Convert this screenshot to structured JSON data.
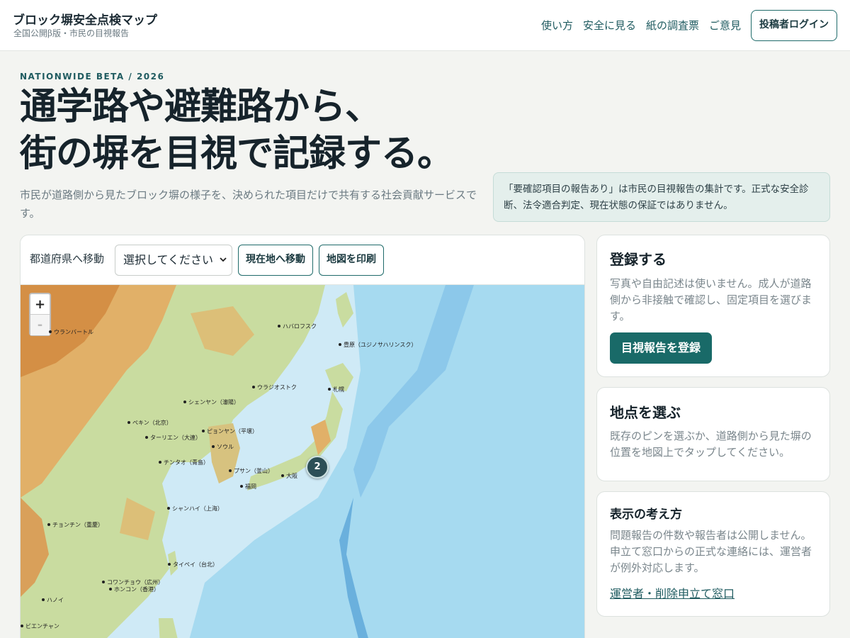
{
  "header": {
    "title": "ブロック塀安全点検マップ",
    "subtitle": "全国公開β版・市民の目視報告",
    "nav": [
      "使い方",
      "安全に見る",
      "紙の調査票",
      "ご意見"
    ],
    "login_label": "投稿者ログイン"
  },
  "hero": {
    "eyebrow": "NATIONWIDE BETA / 2026",
    "headline_line1": "通学路や避難路から、",
    "headline_line2": "街の塀を目視で記録する。",
    "lede": "市民が道路側から見たブロック塀の様子を、決められた項目だけで共有する社会貢献サービスです。",
    "notice": "「要確認項目の報告あり」は市民の目視報告の集計です。正式な安全診断、法令適合判定、現在状態の保証ではありません。"
  },
  "map": {
    "pref_label": "都道府県へ移動",
    "pref_select_value": "選択してください",
    "locate_label": "現在地へ移動",
    "print_label": "地図を印刷",
    "zoom_in": "+",
    "zoom_out": "-",
    "cluster_count": "2",
    "cities": [
      "ウランバートル",
      "ハバロフスク",
      "豊原（ユジノサハリンスク）",
      "札幌",
      "ウラジオストク",
      "シェンヤン（瀋陽）",
      "ペキン（北京）",
      "ピョンヤン（平壌）",
      "ターリエン（大連）",
      "ソウル",
      "チンタオ（青島）",
      "プサン（釜山）",
      "大阪",
      "福岡",
      "シャンハイ（上海）",
      "チョンチン（重慶）",
      "タイペイ（台北）",
      "コワンチョウ（広州）",
      "ホンコン（香港）",
      "ハノイ",
      "ビエンチャン"
    ]
  },
  "cards": {
    "register": {
      "title": "登録する",
      "body": "写真や自由記述は使いません。成人が道路側から非接触で確認し、固定項目を選びます。",
      "button": "目視報告を登録"
    },
    "select": {
      "title": "地点を選ぶ",
      "body": "既存のピンを選ぶか、道路側から見た塀の位置を地図上でタップしてください。"
    },
    "policy": {
      "title": "表示の考え方",
      "body": "問題報告の件数や報告者は公開しません。申立て窓口からの正式な連絡には、運営者が例外対応します。",
      "link": "運営者・削除申立て窓口"
    }
  },
  "colors": {
    "accent": "#196a68",
    "ocean": "#a8dcef",
    "land_green": "#c8dc9a",
    "land_orange": "#e2a65a"
  }
}
